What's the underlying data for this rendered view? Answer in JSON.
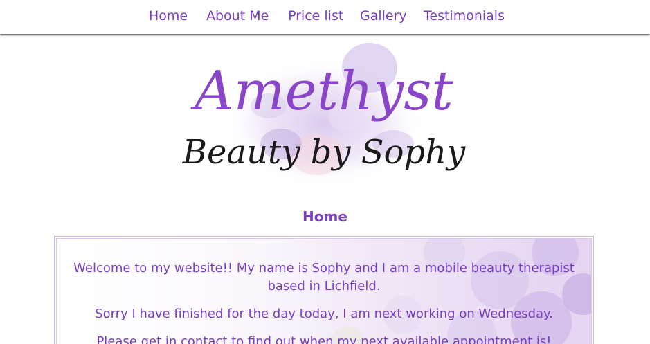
{
  "nav": {
    "items": [
      {
        "label": "Home"
      },
      {
        "label": "About Me"
      },
      {
        "label": "Price list"
      },
      {
        "label": "Gallery"
      },
      {
        "label": "Testimonials"
      }
    ]
  },
  "header": {
    "logo_title": "Amethyst",
    "logo_subtitle": "Beauty by Sophy"
  },
  "main": {
    "page_title": "Home",
    "paragraphs": [
      "Welcome to my website!! My name is Sophy and I am a mobile beauty therapist based in Lichfield.",
      "Sorry I have finished for the day today, I am next working on Wednesday.",
      "Please get in contact to find out when my next available appointment is!"
    ]
  },
  "colors": {
    "accent": "#7a3fc0",
    "box_border": "#d2b8ea"
  }
}
